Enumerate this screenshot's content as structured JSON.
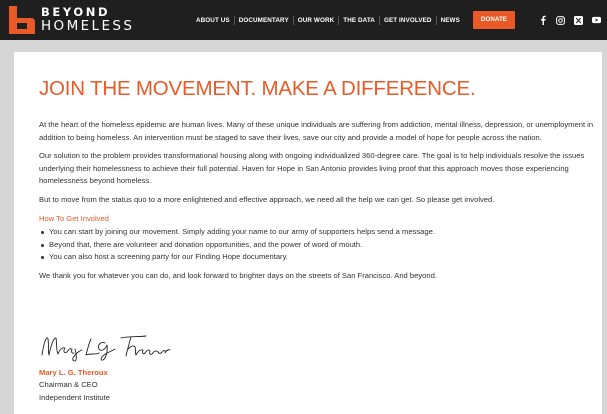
{
  "header": {
    "brand_line1": "BEYOND",
    "brand_line2": "HOMELESS",
    "nav": [
      {
        "label": "ABOUT US"
      },
      {
        "label": "DOCUMENTARY"
      },
      {
        "label": "OUR WORK"
      },
      {
        "label": "THE DATA"
      },
      {
        "label": "GET INVOLVED"
      },
      {
        "label": "NEWS"
      }
    ],
    "donate_label": "DONATE",
    "social_icons": [
      "facebook-icon",
      "instagram-icon",
      "x-icon",
      "youtube-icon"
    ],
    "accent_color": "#ea5a26",
    "background_color": "#1f1f1f"
  },
  "main": {
    "title": "JOIN THE MOVEMENT. MAKE A DIFFERENCE.",
    "paragraphs": [
      "At the heart of the homeless epidemic are human lives. Many of these unique individuals are suffering from addiction, mental illness, depression, or unemployment in addition to being homeless. An intervention must be staged to save their lives, save our city and provide a model of hope for people across the nation.",
      "Our solution to the problem provides transformational housing along with ongoing individualized 360-degree care. The goal is to help individuals resolve the issues underlying their homelessness to achieve their full potential. Haven for Hope in San Antonio provides living proof that this approach moves those experiencing homelessness beyond homeless.",
      "But to move from the status quo to a more enlightened and effective approach, we need all the help we can get. So please get involved."
    ],
    "involve_heading": "How To Get Involved",
    "bullets": [
      "You can start by joining our movement. Simply adding your name to our army of supporters helps send a message.",
      "Beyond that, there are volunteer and donation opportunities, and the power of word of mouth.",
      "You can also host a screening party for our Finding Hope documentary."
    ],
    "closing": "We thank you for whatever you can do, and look forward to brighter days on the streets of San Francisco. And beyond.",
    "signer_name": "Mary L. G. Theroux",
    "signer_title": "Chairman & CEO",
    "signer_org": "Independent Institute"
  }
}
